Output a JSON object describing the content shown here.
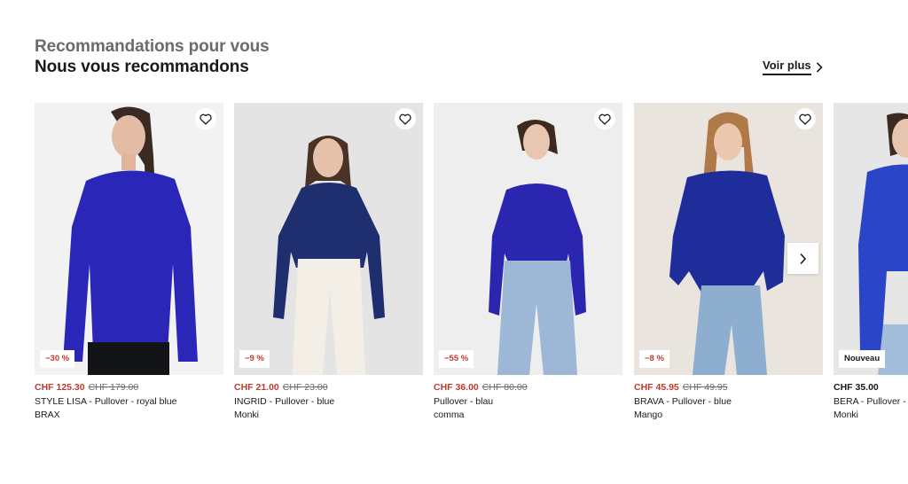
{
  "header": {
    "subtitle": "Recommandations pour vous",
    "title": "Nous vous recommandons",
    "see_more": "Voir plus"
  },
  "colors": {
    "sale": "#c0392b",
    "text": "#1a1a1a",
    "muted": "#6b6b6b"
  },
  "products": [
    {
      "badge": "−30 %",
      "price": "CHF 125.30",
      "old_price": "CHF 179.00",
      "name": "STYLE LISA - Pullover - royal blue",
      "brand": "BRAX"
    },
    {
      "badge": "−9 %",
      "price": "CHF 21.00",
      "old_price": "CHF 23.00",
      "name": "INGRID - Pullover - blue",
      "brand": "Monki"
    },
    {
      "badge": "−55 %",
      "price": "CHF 36.00",
      "old_price": "CHF 80.00",
      "name": "Pullover - blau",
      "brand": "comma"
    },
    {
      "badge": "−8 %",
      "price": "CHF 45.95",
      "old_price": "CHF 49.95",
      "name": "BRAVA - Pullover - blue",
      "brand": "Mango"
    },
    {
      "badge": "Nouveau",
      "price": "CHF 35.00",
      "old_price": "",
      "name": "BERA - Pullover - blue",
      "brand": "Monki"
    }
  ],
  "icons": {
    "wishlist": "heart-icon",
    "next": "chevron-right-icon",
    "see_more": "chevron-right-icon"
  }
}
